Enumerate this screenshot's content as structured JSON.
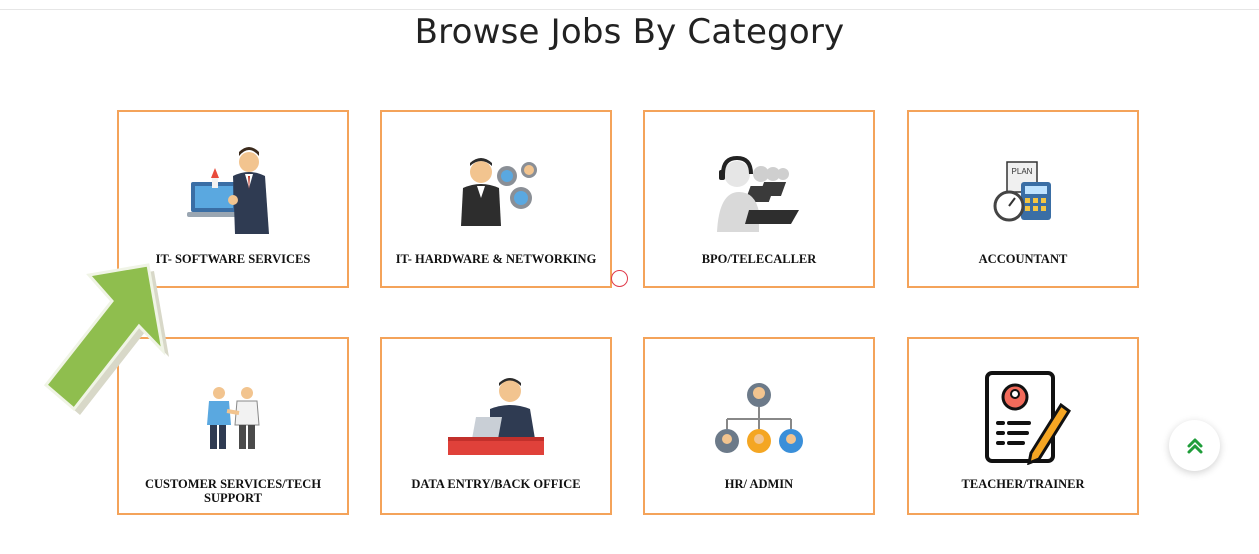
{
  "heading": "Browse Jobs By Category",
  "categories": [
    {
      "label": "IT- SOFTWARE SERVICES",
      "icon": "software-developer-icon"
    },
    {
      "label": "IT- HARDWARE & NETWORKING",
      "icon": "hardware-networking-icon"
    },
    {
      "label": "BPO/TELECALLER",
      "icon": "call-center-icon"
    },
    {
      "label": "ACCOUNTANT",
      "icon": "accounting-calculator-icon"
    },
    {
      "label": "CUSTOMER SERVICES/TECH SUPPORT",
      "icon": "handshake-icon"
    },
    {
      "label": "DATA ENTRY/BACK OFFICE",
      "icon": "data-entry-icon"
    },
    {
      "label": "HR/ ADMIN",
      "icon": "org-chart-icon"
    },
    {
      "label": "TEACHER/TRAINER",
      "icon": "resume-pen-icon"
    }
  ],
  "accountant_plan_text": "PLAN",
  "colors": {
    "card_border": "#f4a35a",
    "arrow_green": "#8fbe4e",
    "scroll_icon": "#1f9d3a"
  }
}
